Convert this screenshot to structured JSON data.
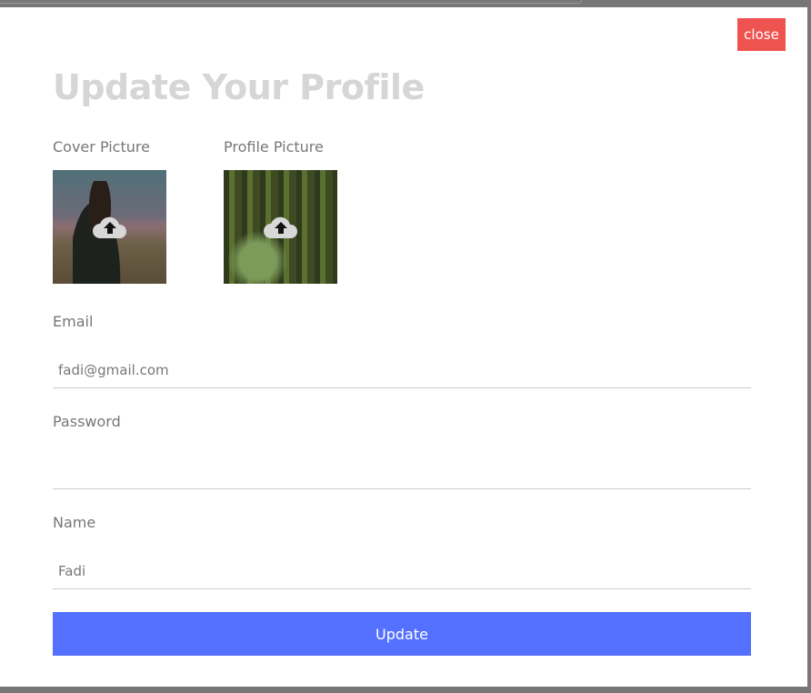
{
  "modal": {
    "close_label": "close",
    "title": "Update Your Profile",
    "cover_label": "Cover Picture",
    "profile_label": "Profile Picture",
    "email_label": "Email",
    "email_value": "fadi@gmail.com",
    "password_label": "Password",
    "password_value": "",
    "name_label": "Name",
    "name_value": "Fadi",
    "update_label": "Update"
  },
  "colors": {
    "close": "#ef5350",
    "update": "#5470ff"
  }
}
